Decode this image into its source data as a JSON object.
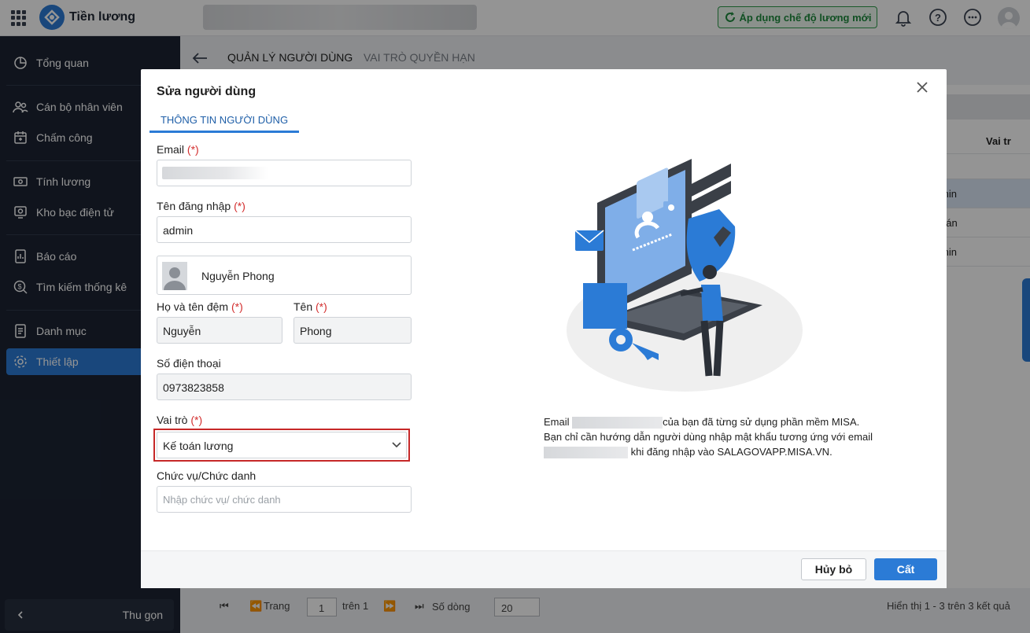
{
  "app": {
    "title": "Tiền lương"
  },
  "header": {
    "apply_label": "Áp dụng chế độ lương mới"
  },
  "sidebar": {
    "items": [
      {
        "label": "Tổng quan",
        "icon": "pie-chart-icon"
      },
      {
        "label": "Cán bộ nhân viên",
        "icon": "users-icon"
      },
      {
        "label": "Chấm công",
        "icon": "calendar-icon"
      },
      {
        "label": "Tính lương",
        "icon": "money-icon"
      },
      {
        "label": "Kho bạc điện tử",
        "icon": "treasury-icon"
      },
      {
        "label": "Báo cáo",
        "icon": "report-icon"
      },
      {
        "label": "Tìm kiếm thống kê",
        "icon": "search-dollar-icon"
      },
      {
        "label": "Danh mục",
        "icon": "list-icon"
      },
      {
        "label": "Thiết lập",
        "icon": "gear-icon"
      }
    ],
    "active": "Thiết lập",
    "collapse_label": "Thu gọn"
  },
  "page": {
    "tabs": [
      "QUẢN LÝ NGƯỜI DÙNG",
      "VAI TRÒ QUYỀN HẠN"
    ],
    "table": {
      "visible_header": "Vai tr",
      "visible_cells": [
        "min",
        "oán",
        "min"
      ]
    },
    "pager": {
      "page_label": "Trang",
      "page_value": "1",
      "of_label": "trên 1",
      "rows_label": "Số dòng",
      "rows_value": "20",
      "summary": "Hiển thị 1 - 3 trên 3 kết quả"
    }
  },
  "modal": {
    "title": "Sửa người dùng",
    "tab": "THÔNG TIN NGƯỜI DÙNG",
    "required_mark": "(*)",
    "email_label": "Email",
    "username_label": "Tên đăng nhập",
    "username_value": "admin",
    "user_card_name": "Nguyễn Phong",
    "middle_name_label": "Họ và tên đệm",
    "middle_name_value": "Nguyễn",
    "first_name_label": "Tên",
    "first_name_value": "Phong",
    "phone_label": "Số điện thoại",
    "phone_value": "0973823858",
    "role_label": "Vai trò",
    "role_value": "Kế toán lương",
    "position_label": "Chức vụ/Chức danh",
    "position_placeholder": "Nhập chức vụ/ chức danh",
    "info_line1_a": "Email",
    "info_line1_b": "của bạn đã từng sử dụng phần mềm MISA.",
    "info_line2": "Bạn chỉ cần hướng dẫn người dùng nhập mật khẩu tương ứng với email",
    "info_line3_b": "khi đăng nhập vào SALAGOVAPP.MISA.VN.",
    "cancel_label": "Hủy bỏ",
    "save_label": "Cất"
  },
  "colors": {
    "accent": "#2b7bd6",
    "sidebar": "#1c2433",
    "required": "#d32f2f",
    "highlight": "#c62828",
    "apply": "#1e8a3d"
  }
}
